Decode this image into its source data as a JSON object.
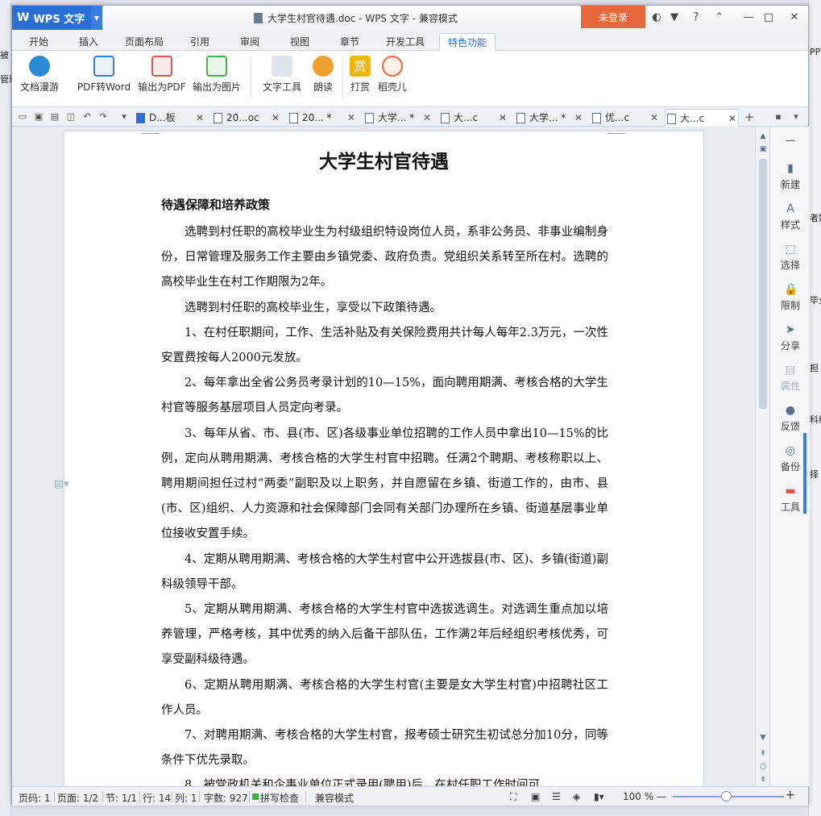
{
  "window": {
    "app_name": "WPS 文字",
    "logo": "W",
    "title": "大学生村官待遇.doc - WPS 文字 - 兼容模式",
    "login_label": "未登录",
    "help_label": "?"
  },
  "menu": {
    "tabs": [
      "开始",
      "插入",
      "页面布局",
      "引用",
      "审阅",
      "视图",
      "章节",
      "开发工具",
      "特色功能"
    ],
    "active": "特色功能"
  },
  "ribbon": {
    "buttons": [
      {
        "label": "文档漫游",
        "icon": "cloud-icon",
        "color": "#2b8ad6"
      },
      {
        "label": "PDF转Word",
        "icon": "pdf-to-word-icon",
        "color": "#3a7bd5"
      },
      {
        "label": "输出为PDF",
        "icon": "export-pdf-icon",
        "color": "#d9534f"
      },
      {
        "label": "输出为图片",
        "icon": "export-image-icon",
        "color": "#4caf50"
      },
      {
        "label": "文字工具",
        "icon": "text-tool-icon",
        "color": "#6d7c8d"
      },
      {
        "label": "朗读",
        "icon": "microphone-icon",
        "color": "#f0a030"
      },
      {
        "label": "打赏",
        "icon": "reward-icon",
        "color": "#f0b800"
      },
      {
        "label": "稻壳儿",
        "icon": "docer-icon",
        "color": "#e9673e"
      }
    ],
    "reward_glyph": "赏"
  },
  "doc_tabs": [
    {
      "label": "D...板",
      "active": false
    },
    {
      "label": "20...oc",
      "active": false
    },
    {
      "label": "20... *",
      "active": false
    },
    {
      "label": "大学... *",
      "active": false
    },
    {
      "label": "大...c",
      "active": false
    },
    {
      "label": "大学... *",
      "active": false
    },
    {
      "label": "优...c",
      "active": false
    },
    {
      "label": "大...c",
      "active": true
    }
  ],
  "document": {
    "title": "大学生村官待遇",
    "heading": "待遇保障和培养政策",
    "paragraphs": [
      "选聘到村任职的高校毕业生为村级组织特设岗位人员，系非公务员、非事业编制身份，日常管理及服务工作主要由乡镇党委、政府负责。党组织关系转至所在村。选聘的高校毕业生在村工作期限为2年。",
      "选聘到村任职的高校毕业生，享受以下政策待遇。",
      "1、在村任职期间，工作、生活补贴及有关保险费用共计每人每年2.3万元，一次性安置费按每人2000元发放。",
      "2、每年拿出全省公务员考录计划的10—15%，面向聘用期满、考核合格的大学生村官等服务基层项目人员定向考录。",
      "3、每年从省、市、县(市、区)各级事业单位招聘的工作人员中拿出10—15%的比例，定向从聘用期满、考核合格的大学生村官中招聘。任满2个聘期、考核称职以上、聘用期间担任过村“两委”副职及以上职务，并自愿留在乡镇、街道工作的，由市、县(市、区)组织、人力资源和社会保障部门会同有关部门办理所在乡镇、街道基层事业单位接收安置手续。",
      "4、定期从聘用期满、考核合格的大学生村官中公开选拔县(市、区)、乡镇(街道)副科级领导干部。",
      "5、定期从聘用期满、考核合格的大学生村官中选拔选调生。对选调生重点加以培养管理，严格考核，其中优秀的纳入后备干部队伍，工作满2年后经组织考核优秀，可享受副科级待遇。",
      "6、定期从聘用期满、考核合格的大学生村官(主要是女大学生村官)中招聘社区工作人员。",
      "7、对聘用期满、考核合格的大学生村官，报考硕士研究生初试总分加10分，同等条件下优先录取。",
      "8、被党政机关和企事业单位正式录用(聘用)后，在村任职工作时间可"
    ]
  },
  "right_panel": [
    {
      "label": "新建",
      "icon": "new-doc-icon",
      "glyph": "▮",
      "disabled": false
    },
    {
      "label": "样式",
      "icon": "style-icon",
      "glyph": "A",
      "disabled": false
    },
    {
      "label": "选择",
      "icon": "select-icon",
      "glyph": "⬚",
      "disabled": false
    },
    {
      "label": "限制",
      "icon": "restrict-icon",
      "glyph": "🔒",
      "disabled": false
    },
    {
      "label": "分享",
      "icon": "share-icon",
      "glyph": "➤",
      "disabled": false
    },
    {
      "label": "属性",
      "icon": "properties-icon",
      "glyph": "▤",
      "disabled": true
    },
    {
      "label": "反馈",
      "icon": "feedback-icon",
      "glyph": "●",
      "disabled": false
    },
    {
      "label": "备份",
      "icon": "backup-icon",
      "glyph": "◎",
      "disabled": false
    },
    {
      "label": "工具",
      "icon": "toolbox-icon",
      "glyph": "▬",
      "disabled": false
    }
  ],
  "status": {
    "page_code": "页码: 1",
    "page": "页面: 1/2",
    "section": "节: 1/1",
    "row": "行: 14",
    "col": "列: 1",
    "words": "字数: 927",
    "spell": "拼写检查",
    "compat": "兼容模式",
    "zoom": "100 %",
    "zoom_minus": "—",
    "zoom_plus": "+"
  },
  "background": {
    "left_fragments": [
      "被",
      "管理"
    ],
    "right_fragments": [
      "PPT",
      "者好",
      "毕业",
      "担",
      "科级",
      "择"
    ]
  }
}
